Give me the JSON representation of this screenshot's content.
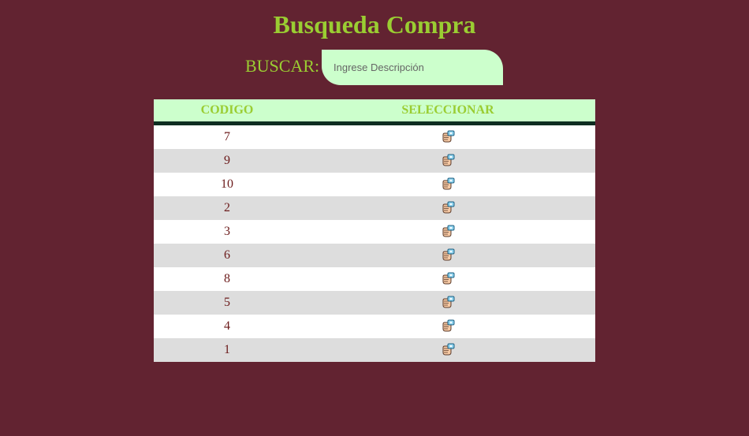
{
  "page": {
    "title": "Busqueda Compra"
  },
  "search": {
    "label": "BUSCAR:",
    "placeholder": "Ingrese Descripción",
    "value": ""
  },
  "table": {
    "columns": [
      "CODIGO",
      "SELECCIONAR"
    ],
    "rows": [
      {
        "codigo": "7",
        "select_icon": "select-hand-icon"
      },
      {
        "codigo": "9",
        "select_icon": "select-hand-icon"
      },
      {
        "codigo": "10",
        "select_icon": "select-hand-icon"
      },
      {
        "codigo": "2",
        "select_icon": "select-hand-icon"
      },
      {
        "codigo": "3",
        "select_icon": "select-hand-icon"
      },
      {
        "codigo": "6",
        "select_icon": "select-hand-icon"
      },
      {
        "codigo": "8",
        "select_icon": "select-hand-icon"
      },
      {
        "codigo": "5",
        "select_icon": "select-hand-icon"
      },
      {
        "codigo": "4",
        "select_icon": "select-hand-icon"
      },
      {
        "codigo": "1",
        "select_icon": "select-hand-icon"
      }
    ]
  },
  "colors": {
    "background": "#622331",
    "accent": "#9acd32",
    "header_bg": "#ccffcc",
    "header_border": "#0f2e22",
    "row_odd": "#ffffff",
    "row_even": "#dddddd",
    "cell_text": "#6b1a1a"
  }
}
